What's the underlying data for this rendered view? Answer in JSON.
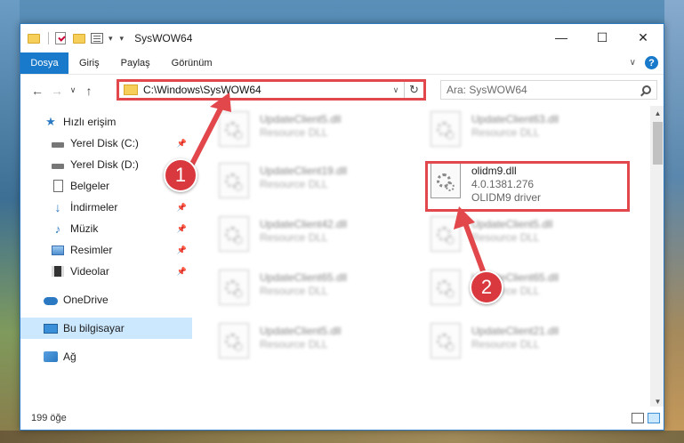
{
  "window": {
    "title": "SysWOW64",
    "controls": {
      "minimize": "—",
      "maximize": "☐",
      "close": "✕"
    }
  },
  "menu": {
    "file": "Dosya",
    "items": [
      "Giriş",
      "Paylaş",
      "Görünüm"
    ],
    "help": "?"
  },
  "nav": {
    "back": "←",
    "forward": "→",
    "recent": "∨",
    "up": "↑",
    "address": "C:\\Windows\\SysWOW64",
    "search_placeholder": "Ara: SysWOW64"
  },
  "sidebar": {
    "quick_access": "Hızlı erişim",
    "items": [
      {
        "label": "Yerel Disk (C:)",
        "icon": "disk-icon",
        "pinned": true
      },
      {
        "label": "Yerel Disk (D:)",
        "icon": "disk-icon",
        "pinned": false
      },
      {
        "label": "Belgeler",
        "icon": "document-icon",
        "pinned": true
      },
      {
        "label": "İndirmeler",
        "icon": "download-icon",
        "pinned": true
      },
      {
        "label": "Müzik",
        "icon": "music-icon",
        "pinned": true
      },
      {
        "label": "Resimler",
        "icon": "pictures-icon",
        "pinned": true
      },
      {
        "label": "Videolar",
        "icon": "videos-icon",
        "pinned": true
      }
    ],
    "onedrive": "OneDrive",
    "this_pc": "Bu bilgisayar",
    "network": "Ağ"
  },
  "files": [
    {
      "name": "UpdateClient5.dll",
      "desc": "Resource DLL"
    },
    {
      "name": "UpdateClient63.dll",
      "desc": "Resource DLL"
    },
    {
      "name": "UpdateClient19.dll",
      "desc": "Resource DLL"
    },
    {
      "name": "olidm9.dll",
      "version": "4.0.1381.276",
      "desc": "OLIDM9 driver"
    },
    {
      "name": "UpdateClient42.dll",
      "desc": "Resource DLL"
    },
    {
      "name": "UpdateClient5.dll",
      "desc": "Resource DLL"
    },
    {
      "name": "UpdateClient65.dll",
      "desc": "Resource DLL"
    },
    {
      "name": "UpdateClient65.dll",
      "desc": "Resource DLL"
    },
    {
      "name": "UpdateClient5.dll",
      "desc": "Resource DLL"
    },
    {
      "name": "UpdateClient21.dll",
      "desc": "Resource DLL"
    }
  ],
  "status": {
    "count": "199 öğe"
  },
  "annotations": {
    "badge1": "1",
    "badge2": "2"
  },
  "colors": {
    "accent": "#1979ca",
    "highlight": "#e2474b",
    "selected": "#cce8ff"
  }
}
